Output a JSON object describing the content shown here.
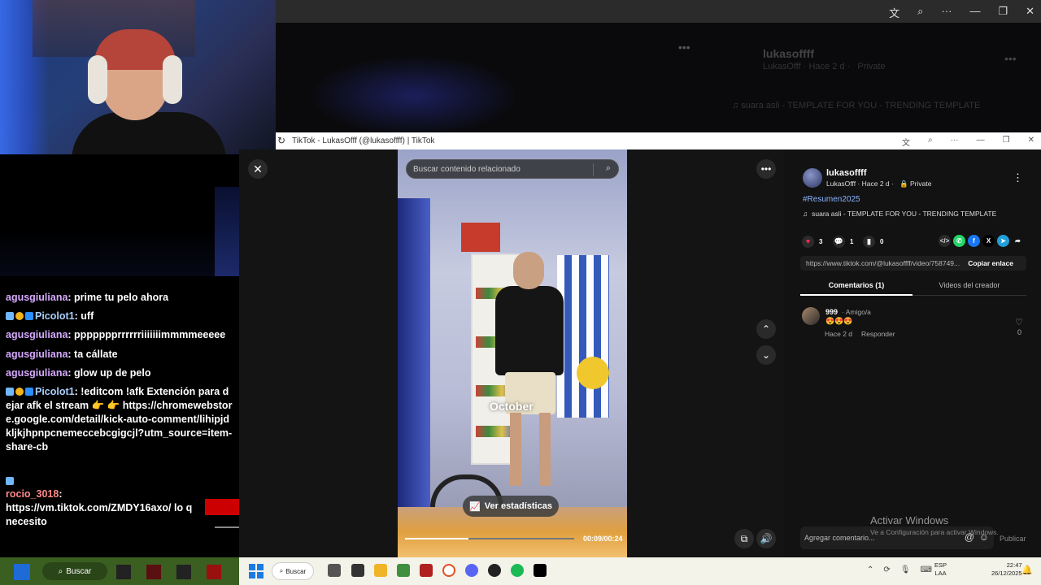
{
  "top_browser": {
    "icons": [
      "translate-icon",
      "search-icon",
      "more-icon",
      "minimize-icon",
      "restore-icon",
      "close-icon"
    ],
    "bg_username": "lukasoffff",
    "bg_subtitle": "LukasOfff · Hace 2 d ·",
    "bg_privacy": "Private",
    "bg_song": "♫  suara asli - TEMPLATE FOR YOU - TRENDING TEMPLATE"
  },
  "chat": {
    "messages": [
      {
        "user": "agusgiuliana",
        "text": " prime tu pelo ahora"
      },
      {
        "user": "Picolot1",
        "text": " uff"
      },
      {
        "user": "agusgiuliana",
        "text": " ppppppprrrrrriiiiiiimmmmeeeee"
      },
      {
        "user": "agusgiuliana",
        "text": " ta cállate"
      },
      {
        "user": "agusgiuliana",
        "text": " glow up de pelo"
      },
      {
        "user": "Picolot1",
        "text": " !editcom !afk Extención para dejar afk el stream 👉 👉 https://chromewebstore.google.com/detail/kick-auto-comment/lihipjdkljkjhpnpcnemeccebcgigcjl?utm_source=item-share-cb"
      },
      {
        "user": "rocio_3018",
        "text": " https://vm.tiktok.com/ZMDY16axo/ lo q necesito"
      }
    ]
  },
  "tiktok": {
    "window_title": "TikTok - LukasOfff (@lukasoffff) | TikTok",
    "search_placeholder": "Buscar contenido relacionado",
    "video_caption": "October",
    "stats_button": "Ver estadísticas",
    "progress": 0.375,
    "time": "00:09/00:24",
    "username": "lukasoffff",
    "subtitle": "LukasOfff · Hace 2 d ·",
    "privacy": "Private",
    "hashtag": "#Resumen2025",
    "song": "suara asli - TEMPLATE FOR YOU - TRENDING TEMPLATE",
    "likes": "3",
    "comments_count": "1",
    "saves": "0",
    "link": "https://www.tiktok.com/@lukasoffff/video/758749...",
    "copy_link": "Copiar enlace",
    "tab_comments": "Comentarios (1)",
    "tab_videos": "Videos del creador",
    "comment": {
      "user": "999",
      "tag": "· Amigo/a",
      "text": "😍😍😍",
      "date": "Hace 2 d",
      "reply": "Responder",
      "likes": "0"
    },
    "comment_placeholder": "Agregar comentario...",
    "publish": "Publicar"
  },
  "windows": {
    "activate_title": "Activar Windows",
    "activate_sub": "Ve a Configuración para activar Windows.",
    "search_left": "Buscar",
    "search_right": "Buscar",
    "lang_1": "ESP",
    "lang_2": "LAA",
    "time": "22:47",
    "date": "26/12/2025"
  },
  "colors": {
    "accent_like": "#fe2c55",
    "hashtag": "#8ab4ff",
    "whatsapp": "#25d366",
    "facebook": "#1877f2",
    "telegram": "#229ed9"
  }
}
